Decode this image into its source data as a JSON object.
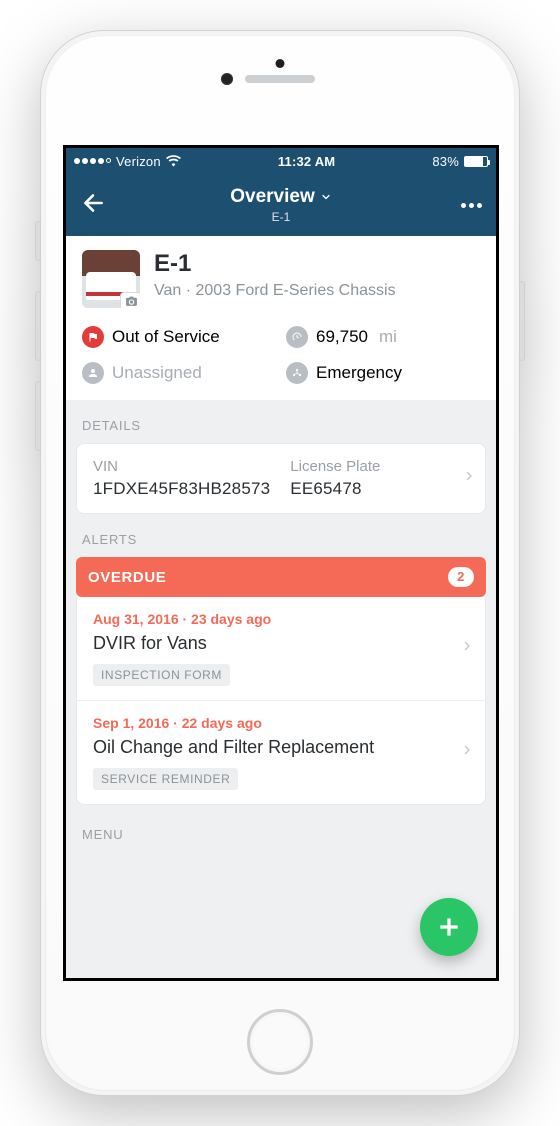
{
  "statusbar": {
    "carrier": "Verizon",
    "time": "11:32 AM",
    "battery_pct": "83%"
  },
  "nav": {
    "title": "Overview",
    "subtitle": "E-1"
  },
  "vehicle": {
    "name": "E-1",
    "subtitle": "Van · 2003 Ford E-Series Chassis",
    "status": "Out of Service",
    "odometer_value": "69,750",
    "odometer_unit": "mi",
    "assignee": "Unassigned",
    "group": "Emergency"
  },
  "sections": {
    "details_label": "DETAILS",
    "alerts_label": "ALERTS",
    "menu_label": "MENU"
  },
  "details": {
    "vin_label": "VIN",
    "vin_value": "1FDXE45F83HB28573",
    "plate_label": "License Plate",
    "plate_value": "EE65478"
  },
  "alerts": {
    "overdue_label": "OVERDUE",
    "overdue_count": "2",
    "items": [
      {
        "date": "Aug 31, 2016 · 23 days ago",
        "title": "DVIR for Vans",
        "tag": "INSPECTION FORM"
      },
      {
        "date": "Sep 1, 2016 · 22 days ago",
        "title": "Oil Change and Filter Replacement",
        "tag": "SERVICE REMINDER"
      }
    ]
  }
}
